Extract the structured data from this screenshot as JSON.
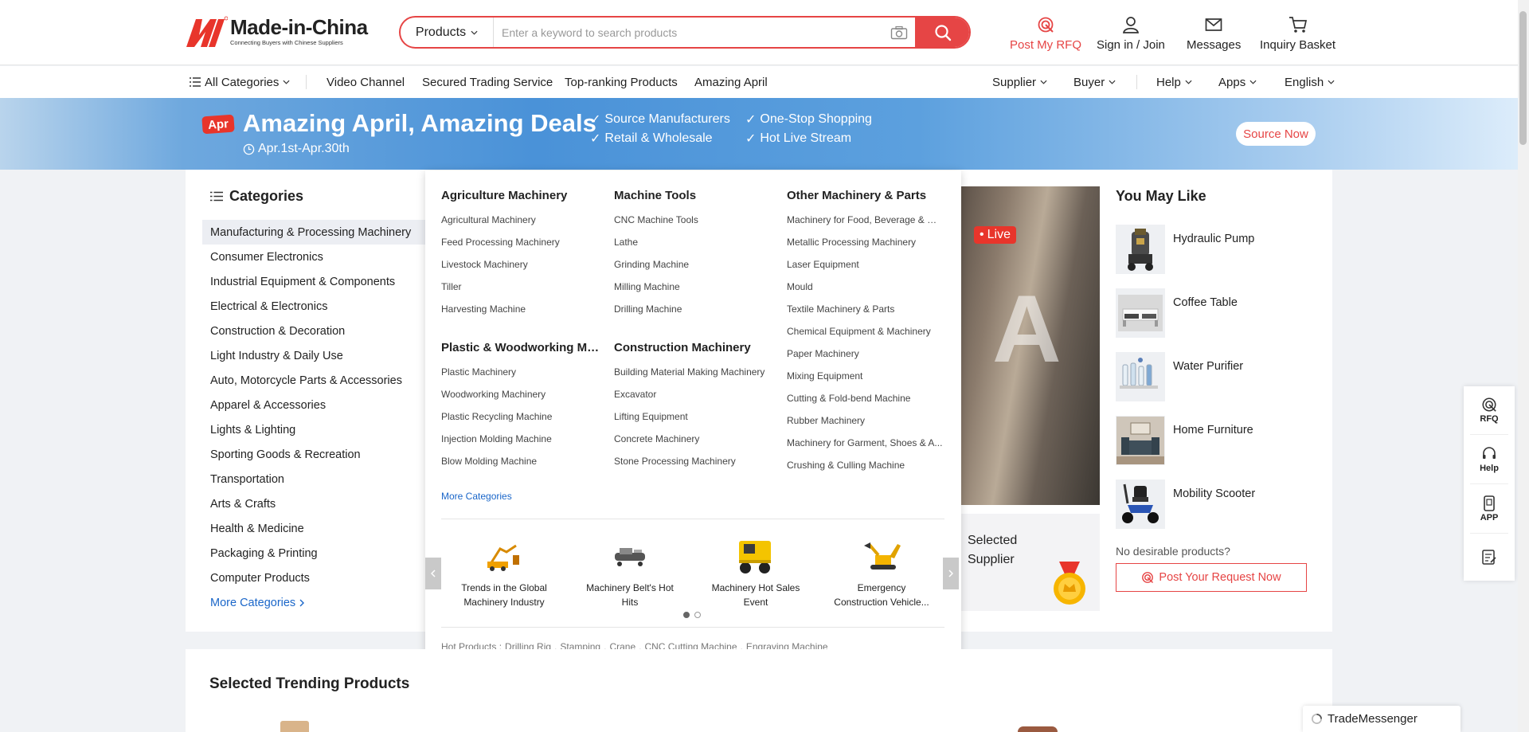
{
  "brand": {
    "name": "Made-in-China",
    "tagline": "Connecting Buyers with Chinese Suppliers",
    "accent": "#e64545"
  },
  "search": {
    "category": "Products",
    "placeholder": "Enter a keyword to search products"
  },
  "header_actions": [
    {
      "label": "Post My RFQ",
      "icon": "rfq-icon",
      "color": "#e64545"
    },
    {
      "label": "Sign in / Join",
      "icon": "user-icon"
    },
    {
      "label": "Messages",
      "icon": "mail-icon"
    },
    {
      "label": "Inquiry Basket",
      "icon": "cart-icon"
    }
  ],
  "nav": {
    "all_categories": "All Categories",
    "links": [
      "Video Channel",
      "Secured Trading Service",
      "Top-ranking Products",
      "Amazing April"
    ],
    "right": [
      "Supplier",
      "Buyer",
      "Help",
      "Apps",
      "English"
    ]
  },
  "banner": {
    "badge": "Apr",
    "title": "Amazing April, Amazing Deals",
    "date": "Apr.1st-Apr.30th",
    "features": [
      "Source Manufacturers",
      "One-Stop Shopping",
      "Retail & Wholesale",
      "Hot Live Stream"
    ],
    "cta": "Source Now"
  },
  "categories": {
    "title": "Categories",
    "items": [
      "Manufacturing & Processing Machinery",
      "Consumer Electronics",
      "Industrial Equipment & Components",
      "Electrical & Electronics",
      "Construction & Decoration",
      "Light Industry & Daily Use",
      "Auto, Motorcycle Parts & Accessories",
      "Apparel & Accessories",
      "Lights & Lighting",
      "Sporting Goods & Recreation",
      "Transportation",
      "Arts & Crafts",
      "Health & Medicine",
      "Packaging & Printing",
      "Computer Products"
    ],
    "more": "More Categories"
  },
  "panel": {
    "groups": [
      {
        "title": "Agriculture Machinery",
        "items": [
          "Agricultural Machinery",
          "Feed Processing Machinery",
          "Livestock Machinery",
          "Tiller",
          "Harvesting Machine"
        ]
      },
      {
        "title": "Machine Tools",
        "items": [
          "CNC Machine Tools",
          "Lathe",
          "Grinding Machine",
          "Milling Machine",
          "Drilling Machine"
        ]
      },
      {
        "title": "Other Machinery & Parts",
        "items": [
          "Machinery for Food, Beverage & Ce...",
          "Metallic Processing Machinery",
          "Laser Equipment",
          "Mould",
          "Textile Machinery & Parts",
          "Chemical Equipment & Machinery",
          "Paper Machinery",
          "Mixing Equipment",
          "Cutting & Fold-bend Machine",
          "Rubber Machinery",
          "Machinery for Garment, Shoes & A...",
          "Crushing & Culling Machine"
        ]
      },
      {
        "title": "Plastic & Woodworking Mach...",
        "items": [
          "Plastic Machinery",
          "Woodworking Machinery",
          "Plastic Recycling Machine",
          "Injection Molding Machine",
          "Blow Molding Machine"
        ]
      },
      {
        "title": "Construction Machinery",
        "items": [
          "Building Material Making Machinery",
          "Excavator",
          "Lifting Equipment",
          "Concrete Machinery",
          "Stone Processing Machinery"
        ]
      }
    ],
    "more": "More Categories",
    "carousel": [
      {
        "caption": "Trends in the Global Machinery Industry",
        "icon": "machinery-trend-icon"
      },
      {
        "caption": "Machinery Belt's Hot Hits",
        "icon": "machine-belt-icon"
      },
      {
        "caption": "Machinery Hot Sales Event",
        "icon": "loader-truck-icon"
      },
      {
        "caption": "Emergency Construction Vehicle...",
        "icon": "excavator-icon"
      }
    ],
    "page_count": 2,
    "active_page": 1,
    "hot_label": "Hot Products :",
    "hot": [
      "Drilling Rig",
      "Stamping",
      "Crane",
      "CNC Cutting Machine",
      "Engraving Machine"
    ]
  },
  "live": {
    "badge": "Live",
    "selected_supplier": "Selected Supplier"
  },
  "you_may_like": {
    "title": "You May Like",
    "items": [
      {
        "name": "Hydraulic Pump",
        "icon": "hydraulic-pump-icon"
      },
      {
        "name": "Coffee Table",
        "icon": "coffee-table-icon"
      },
      {
        "name": "Water Purifier",
        "icon": "water-purifier-icon"
      },
      {
        "name": "Home Furniture",
        "icon": "sofa-icon"
      },
      {
        "name": "Mobility Scooter",
        "icon": "scooter-icon"
      }
    ],
    "no_desire": "No desirable products?",
    "cta": "Post Your Request Now"
  },
  "section_title": "Selected Trending Products",
  "side_tools": [
    "RFQ",
    "Help",
    "APP"
  ],
  "trade_messenger": "TradeMessenger"
}
